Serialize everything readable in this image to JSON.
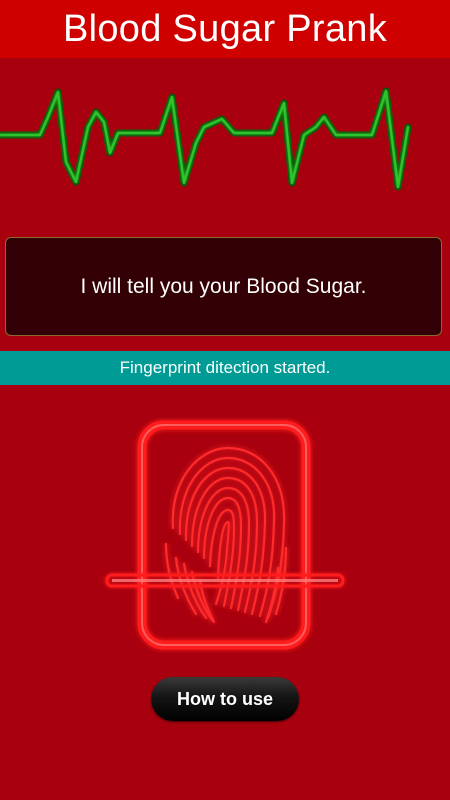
{
  "app": {
    "title": "Blood Sugar Prank"
  },
  "message": {
    "text": "I will tell you your Blood Sugar."
  },
  "status": {
    "text": "Fingerprint ditection started."
  },
  "actions": {
    "how_to_use_label": "How to use"
  },
  "icons": {
    "heartbeat": "heartbeat-line-icon",
    "fingerprint": "fingerprint-icon",
    "scan_line": "scan-line-icon"
  },
  "colors": {
    "background": "#a8000e",
    "title_bar": "#cf0000",
    "message_box": "#330005",
    "status_bar": "#009b94",
    "ecg_line": "#2ec42a",
    "scanner_glow": "#ff1a1a"
  }
}
